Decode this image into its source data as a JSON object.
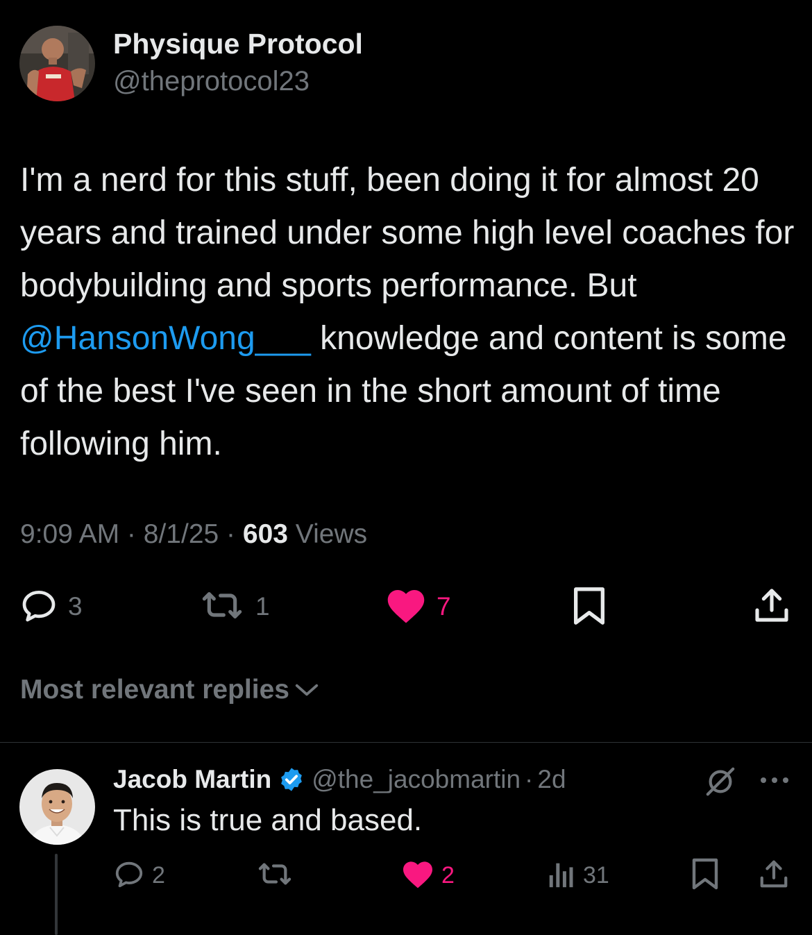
{
  "post": {
    "author": {
      "display_name": "Physique Protocol",
      "handle": "@theprotocol23"
    },
    "text_before_mention": "I'm a nerd for this stuff, been doing it for almost 20 years and trained under some high level coaches for bodybuilding and sports performance. But ",
    "mention": "@HansonWong___",
    "text_after_mention": " knowledge and content is some of the best I've seen in the short amount of time following him.",
    "time": "9:09 AM",
    "separator": " · ",
    "date": "8/1/25",
    "views_count": "603",
    "views_label": " Views",
    "actions": {
      "replies": "3",
      "reposts": "1",
      "likes": "7",
      "liked": true
    }
  },
  "replies_section": {
    "sort_label": "Most relevant replies",
    "sort_icon": "chevron-down-icon"
  },
  "reply": {
    "author": {
      "display_name": "Jacob Martin",
      "handle": "@the_jacobmartin",
      "verified": true
    },
    "dot": "·",
    "time": "2d",
    "text": "This is true and based.",
    "actions": {
      "replies": "2",
      "likes": "2",
      "liked": true,
      "views": "31"
    }
  },
  "colors": {
    "background": "#000000",
    "text": "#e7e9ea",
    "secondary": "#71767b",
    "link": "#1d9bf0",
    "like": "#f91880",
    "verified": "#1d9bf0",
    "divider": "#2f3336"
  }
}
